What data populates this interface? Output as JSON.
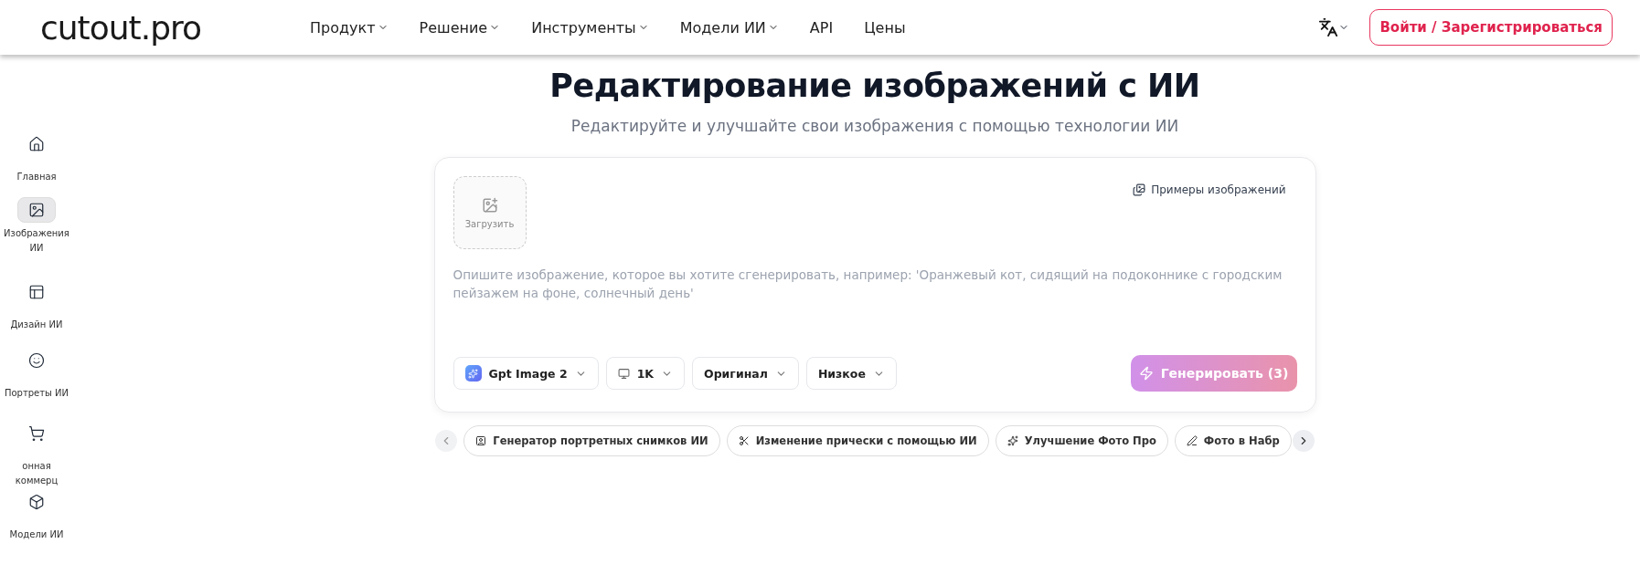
{
  "header": {
    "logo": "cutout.pro",
    "nav": [
      {
        "label": "Продукт",
        "dropdown": true
      },
      {
        "label": "Решение",
        "dropdown": true
      },
      {
        "label": "Инструменты",
        "dropdown": true
      },
      {
        "label": "Модели ИИ",
        "dropdown": true
      },
      {
        "label": "API",
        "dropdown": false
      },
      {
        "label": "Цены",
        "dropdown": false
      }
    ],
    "login": "Войти / Зарегистрироваться"
  },
  "sidebar": {
    "items": [
      {
        "label": "Главная",
        "selected": false
      },
      {
        "label": "Изображения ИИ",
        "selected": true
      },
      {
        "label": "Дизайн ИИ",
        "selected": false
      },
      {
        "label": "Портреты ИИ",
        "selected": false
      },
      {
        "label": "онная коммерц",
        "selected": false
      },
      {
        "label": "Модели ИИ",
        "selected": false
      }
    ]
  },
  "hero": {
    "title": "Редактирование изображений с ИИ",
    "subtitle": "Редактируйте и улучшайте свои изображения с помощью технологии ИИ"
  },
  "editor": {
    "upload": "Загрузить",
    "examples": "Примеры изображений",
    "prompt": {
      "placeholder": "Опишите изображение, которое вы хотите сгенерировать, например: 'Оранжевый кот, сидящий на подоконнике с городским пейзажем на фоне, солнечный день'"
    },
    "options": [
      {
        "kind": "model",
        "label": "Gpt Image 2"
      },
      {
        "kind": "size",
        "label": "1K"
      },
      {
        "kind": "plain",
        "label": "Оригинал"
      },
      {
        "kind": "plain",
        "label": "Низкое"
      }
    ],
    "generate": {
      "label": "Генерировать (3)",
      "disabled": true
    }
  },
  "chips": [
    {
      "label": "Генератор портретных снимков ИИ"
    },
    {
      "label": "Изменение прически с помощью ИИ"
    },
    {
      "label": "Улучшение Фото Про"
    },
    {
      "label": "Фото в Набр"
    }
  ]
}
